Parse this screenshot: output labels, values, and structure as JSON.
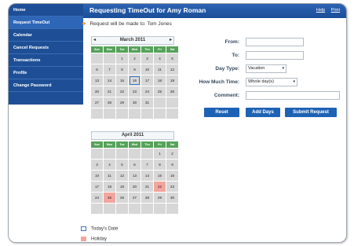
{
  "header": {
    "title": "Requesting TimeOut for Amy Roman",
    "help": "Help",
    "print": "Print"
  },
  "sidebar": {
    "items": [
      {
        "label": "Home",
        "active": false
      },
      {
        "label": "Request TimeOut",
        "active": true
      },
      {
        "label": "Calendar",
        "active": false
      },
      {
        "label": "Cancel Requests",
        "active": false
      },
      {
        "label": "Transactions",
        "active": false
      },
      {
        "label": "Profile",
        "active": false
      },
      {
        "label": "Change Password",
        "active": false
      }
    ]
  },
  "notice": "Request will be made to: Tom Jones",
  "calendars": [
    {
      "month": "March 2011",
      "prev": "◂",
      "next": "▸",
      "dow": [
        "Sun",
        "Mon",
        "Tue",
        "Wed",
        "Thu",
        "Fri",
        "Sat"
      ],
      "cells": [
        "",
        "",
        "1",
        "2",
        "3",
        "4",
        "5",
        "6",
        "7",
        "8",
        "9",
        "10",
        "11",
        "12",
        "13",
        "14",
        "15",
        "16",
        "17",
        "18",
        "19",
        "20",
        "21",
        "22",
        "23",
        "24",
        "25",
        "26",
        "27",
        "28",
        "29",
        "30",
        "31",
        "",
        "",
        "",
        "",
        "",
        "",
        "",
        "",
        ""
      ],
      "today": "16",
      "holidays": []
    },
    {
      "month": "April 2011",
      "prev": "",
      "next": "",
      "dow": [
        "Sun",
        "Mon",
        "Tue",
        "Wed",
        "Thu",
        "Fri",
        "Sat"
      ],
      "cells": [
        "",
        "",
        "",
        "",
        "",
        "1",
        "2",
        "3",
        "4",
        "5",
        "6",
        "7",
        "8",
        "9",
        "10",
        "11",
        "12",
        "13",
        "14",
        "15",
        "16",
        "17",
        "18",
        "19",
        "20",
        "21",
        "22",
        "23",
        "24",
        "25",
        "26",
        "27",
        "28",
        "29",
        "30",
        "",
        "",
        "",
        "",
        "",
        "",
        ""
      ],
      "today": "",
      "holidays": [
        "22",
        "25"
      ]
    }
  ],
  "form": {
    "from_label": "From:",
    "to_label": "To:",
    "day_type_label": "Day Type:",
    "day_type_value": "Vacation",
    "how_much_label": "How Much Time:",
    "how_much_value": "Whole day(s)",
    "comment_label": "Comment:"
  },
  "buttons": {
    "reset": "Reset",
    "add_days": "Add Days",
    "submit": "Submit Request"
  },
  "legend": {
    "today": "Today's Date",
    "holiday": "Holiday"
  },
  "colors": {
    "primary": "#1d62b4",
    "sidebar": "#1e4f96",
    "dow_header": "#55a25a",
    "holiday": "#f3a59e",
    "accent_arrow": "#f08a1c"
  }
}
